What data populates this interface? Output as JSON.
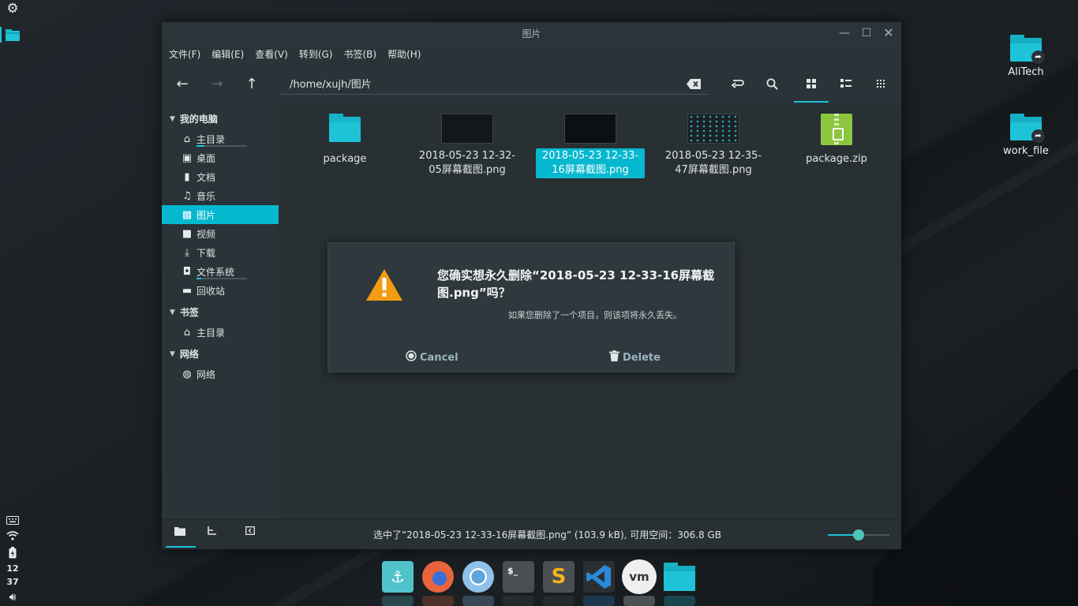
{
  "panel": {
    "clock_hour": "12",
    "clock_min": "37"
  },
  "desktop": {
    "icons": [
      {
        "label": "AliTech"
      },
      {
        "label": "work_file"
      }
    ]
  },
  "window": {
    "title": "图片",
    "menu": [
      "文件(F)",
      "编辑(E)",
      "查看(V)",
      "转到(G)",
      "书签(B)",
      "帮助(H)"
    ],
    "path": "/home/xujh/图片",
    "sidebar": {
      "computer_header": "我的电脑",
      "computer_items": [
        {
          "label": "主目录",
          "icon": "home-icon"
        },
        {
          "label": "桌面",
          "icon": "desktop-icon"
        },
        {
          "label": "文档",
          "icon": "document-icon"
        },
        {
          "label": "音乐",
          "icon": "music-icon"
        },
        {
          "label": "图片",
          "icon": "picture-icon"
        },
        {
          "label": "视频",
          "icon": "video-icon"
        },
        {
          "label": "下载",
          "icon": "download-icon"
        },
        {
          "label": "文件系统",
          "icon": "filesystem-icon"
        },
        {
          "label": "回收站",
          "icon": "trash-icon"
        }
      ],
      "bookmarks_header": "书签",
      "bookmark_items": [
        {
          "label": "主目录",
          "icon": "home-icon"
        }
      ],
      "network_header": "网络",
      "network_items": [
        {
          "label": "网络",
          "icon": "network-icon"
        }
      ]
    },
    "files": [
      {
        "name": "package",
        "type": "folder"
      },
      {
        "name": "2018-05-23 12-32-05屏幕截图.png",
        "type": "image"
      },
      {
        "name": "2018-05-23 12-33-16屏幕截图.png",
        "type": "image",
        "selected": true
      },
      {
        "name": "2018-05-23 12-35-47屏幕截图.png",
        "type": "image"
      },
      {
        "name": "package.zip",
        "type": "zip"
      }
    ],
    "status": "选中了“2018-05-23 12-33-16屏幕截图.png” (103.9 kB), 可用空间：306.8 GB"
  },
  "dialog": {
    "title": "您确实想永久删除“2018-05-23 12-33-16屏幕截图.png”吗？",
    "message": "如果您删除了一个项目，则该项将永久丢失。",
    "cancel_label": "Cancel",
    "delete_label": "Delete"
  },
  "dock": [
    {
      "name": "dock-anchor",
      "label": "⚓",
      "color": "#4fc3c9"
    },
    {
      "name": "dock-firefox",
      "label": "",
      "color": "#e8643c"
    },
    {
      "name": "dock-chromium",
      "label": "",
      "color": "#5da3dc"
    },
    {
      "name": "dock-terminal",
      "label": "$_",
      "color": "#4a4f54"
    },
    {
      "name": "dock-sublime",
      "label": "S",
      "color": "#4a4f54"
    },
    {
      "name": "dock-vscode",
      "label": "",
      "color": "#2a2f33"
    },
    {
      "name": "dock-vmware",
      "label": "vm",
      "color": "#e8e8e8"
    },
    {
      "name": "dock-files",
      "label": "",
      "color": "#1ec3d8"
    }
  ],
  "colors": {
    "accent": "#05b8cf",
    "warning": "#f39c12"
  }
}
